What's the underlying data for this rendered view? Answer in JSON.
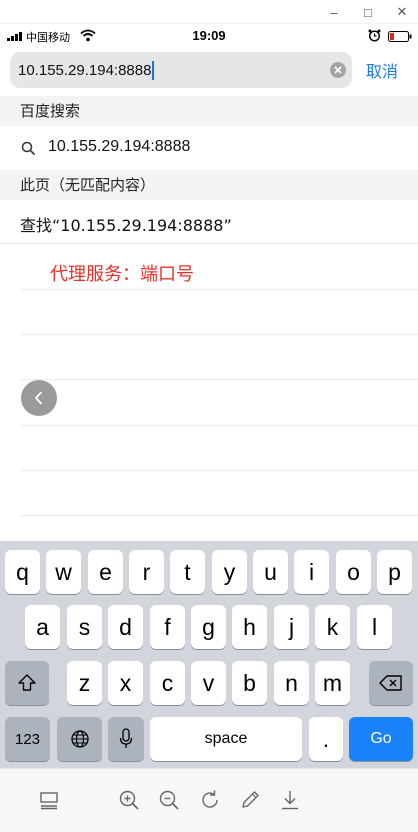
{
  "window": {
    "minimize": "–",
    "maximize": "□",
    "close": "✕"
  },
  "status": {
    "carrier": "中国移动",
    "time": "19:09"
  },
  "address_bar": {
    "url": "10.155.29.194:8888",
    "cancel_label": "取消"
  },
  "sections": [
    {
      "title": "百度搜索"
    },
    {
      "title": "此页（无匹配内容）"
    }
  ],
  "suggestion": {
    "text": "10.155.29.194:8888"
  },
  "find_in_page": {
    "text": "查找“10.155.29.194:8888”"
  },
  "annotation": {
    "text": "代理服务：端口号",
    "color": "#e8322a"
  },
  "keyboard": {
    "row1": [
      "q",
      "w",
      "e",
      "r",
      "t",
      "y",
      "u",
      "i",
      "o",
      "p"
    ],
    "row2": [
      "a",
      "s",
      "d",
      "f",
      "g",
      "h",
      "j",
      "k",
      "l"
    ],
    "row3": [
      "z",
      "x",
      "c",
      "v",
      "b",
      "n",
      "m"
    ],
    "numbers_label": "123",
    "space_label": "space",
    "period_label": ".",
    "go_label": "Go",
    "go_color": "#1a82fb"
  },
  "toolbar": {
    "icons": [
      "tabs-icon",
      "zoom-in-icon",
      "zoom-out-icon",
      "refresh-icon",
      "edit-icon",
      "download-icon"
    ]
  }
}
